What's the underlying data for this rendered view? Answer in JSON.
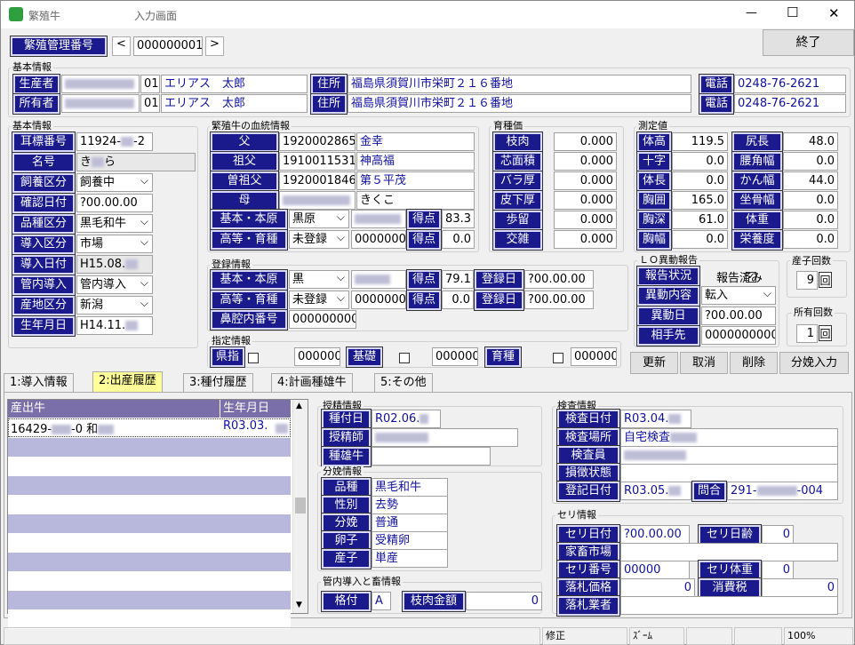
{
  "window": {
    "title": "繁殖牛",
    "subtitle": "入力画面",
    "min": "—",
    "max": "☐",
    "close": "✕"
  },
  "top": {
    "id_label": "繁殖管理番号",
    "prev": "<",
    "id_value": "000000001",
    "next": ">",
    "exit": "終了"
  },
  "basic_group": "基本情報",
  "producer": {
    "label": "生産者",
    "code": "01",
    "name": "エリアス　太郎",
    "addr_label": "住所",
    "addr": "福島県須賀川市栄町２１６番地",
    "tel_label": "電話",
    "tel": "0248-76-2621"
  },
  "owner": {
    "label": "所有者",
    "code": "01",
    "name": "エリアス　太郎",
    "addr_label": "住所",
    "addr": "福島県須賀川市栄町２１６番地",
    "tel_label": "電話",
    "tel": "0248-76-2621"
  },
  "basic2": {
    "title": "基本情報",
    "rows": [
      {
        "label": "耳標番号",
        "value": "11924-",
        "value2": "-2"
      },
      {
        "label": "名号",
        "value": "き",
        "value2": "ら"
      },
      {
        "label": "飼養区分",
        "value": "飼養中"
      },
      {
        "label": "確認日付",
        "value": "?00.00.00"
      },
      {
        "label": "品種区分",
        "value": "黒毛和牛"
      },
      {
        "label": "導入区分",
        "value": "市場"
      },
      {
        "label": "導入日付",
        "value": "H15.08."
      },
      {
        "label": "管内導入",
        "value": "管内導入"
      },
      {
        "label": "産地区分",
        "value": "新潟"
      },
      {
        "label": "生年月日",
        "value": "H14.11."
      }
    ]
  },
  "lineage": {
    "title": "繁殖牛の血統情報",
    "rows": [
      {
        "label": "父",
        "num": "1920002865",
        "name": "金幸"
      },
      {
        "label": "祖父",
        "num": "1910011531",
        "name": "神高福"
      },
      {
        "label": "曽祖父",
        "num": "1920001846",
        "name": "第５平茂"
      },
      {
        "label": "母",
        "num": "",
        "name": "きくこ"
      }
    ],
    "kihon_label": "基本・本原",
    "kihon_sel": "黒原",
    "tokuten": "得点",
    "kihon_score": "83.3",
    "koto_label": "高等・育種",
    "koto_sel": "未登録",
    "koto_num": "0000000",
    "koto_score": "0.0"
  },
  "ikushu": {
    "title": "育種価",
    "rows": [
      {
        "label": "枝肉",
        "value": "0.000"
      },
      {
        "label": "芯面積",
        "value": "0.000"
      },
      {
        "label": "バラ厚",
        "value": "0.000"
      },
      {
        "label": "皮下厚",
        "value": "0.000"
      },
      {
        "label": "歩留",
        "value": "0.000"
      },
      {
        "label": "交雑",
        "value": "0.000"
      }
    ]
  },
  "measure": {
    "title": "測定値",
    "left": [
      {
        "label": "体高",
        "value": "119.5"
      },
      {
        "label": "十字",
        "value": "0.0"
      },
      {
        "label": "体長",
        "value": "0.0"
      },
      {
        "label": "胸囲",
        "value": "165.0"
      },
      {
        "label": "胸深",
        "value": "61.0"
      },
      {
        "label": "胸幅",
        "value": "0.0"
      }
    ],
    "right": [
      {
        "label": "尻長",
        "value": "48.0"
      },
      {
        "label": "腰角幅",
        "value": "0.0"
      },
      {
        "label": "かん幅",
        "value": "44.0"
      },
      {
        "label": "坐骨幅",
        "value": "0.0"
      },
      {
        "label": "体重",
        "value": "0.0"
      },
      {
        "label": "栄養度",
        "value": "0.0"
      }
    ]
  },
  "toroku": {
    "title": "登録情報",
    "kihon_label": "基本・本原",
    "kihon_sel": "黒",
    "tokuten": "得点",
    "kihon_score": "79.1",
    "date_label": "登録日",
    "kihon_date": "?00.00.00",
    "koto_label": "高等・育種",
    "koto_sel": "未登録",
    "koto_num": "0000000",
    "koto_score": "0.0",
    "koto_date": "?00.00.00",
    "bikou_label": "鼻腔内番号",
    "bikou": "000000000"
  },
  "shitei": {
    "title": "指定情報",
    "kenshi": "県指",
    "kenshi_num": "000000",
    "kiso": "基礎",
    "kiso_num": "000000",
    "ikushu": "育種",
    "ikushu_num": "000000"
  },
  "lo": {
    "title": "ＬＯ異動報告",
    "status_label": "報告状況",
    "status_cb": "報告済み",
    "content_label": "異動内容",
    "content": "転入",
    "date_label": "異動日",
    "date": "?00.00.00",
    "partner_label": "相手先",
    "partner": "0000000000"
  },
  "birth_count": {
    "title": "産子回数",
    "value": "9",
    "unit": "回"
  },
  "own_count": {
    "title": "所有回数",
    "value": "1",
    "unit": "回"
  },
  "actions": {
    "update": "更新",
    "cancel": "取消",
    "delete": "削除",
    "calving": "分娩入力"
  },
  "tabs": [
    "1:導入情報",
    "2:出産履歴",
    "3:種付履歴",
    "4:計画種雄牛",
    "5:その他"
  ],
  "grid": {
    "col1": "産出牛",
    "col2": "生年月日",
    "row1_c1": "16429-",
    "row1_c1b": "-0 和",
    "row1_c2": "R03.03."
  },
  "insem": {
    "title": "授精情報",
    "date_label": "種付日",
    "date": "R02.06.",
    "tech_label": "授精師",
    "bull_label": "種雄牛"
  },
  "calving": {
    "title": "分娩情報",
    "rows": [
      {
        "label": "品種",
        "value": "黒毛和牛"
      },
      {
        "label": "性別",
        "value": "去勢"
      },
      {
        "label": "分娩",
        "value": "普通"
      },
      {
        "label": "卵子",
        "value": "受精卵"
      },
      {
        "label": "産子",
        "value": "単産"
      }
    ]
  },
  "intro": {
    "title": "管内導入と畜情報",
    "grade_label": "格付",
    "grade": "A",
    "amount_label": "枝肉金額",
    "amount": "0"
  },
  "inspect": {
    "title": "検査情報",
    "date_label": "検査日付",
    "date": "R03.04.",
    "place_label": "検査場所",
    "place": "自宅検査",
    "inspector_label": "検査員",
    "loss_label": "損徴状態",
    "reg_label": "登記日付",
    "reg": "R03.05.",
    "ask_label": "問合",
    "ask": "291-",
    "ask2": "-004"
  },
  "auction": {
    "title": "セリ情報",
    "date_label": "セリ日付",
    "date": "?00.00.00",
    "age_label": "セリ日齢",
    "age": "0",
    "market_label": "家畜市場",
    "no_label": "セリ番号",
    "no": "00000",
    "weight_label": "セリ体重",
    "weight": "0",
    "price_label": "落札価格",
    "price": "0",
    "tax_label": "消費税",
    "tax": "0",
    "buyer_label": "落札業者"
  },
  "statusbar": {
    "mode": "修正",
    "zoom_label": "ｽﾞｰﾑ",
    "zoom": "100%"
  }
}
